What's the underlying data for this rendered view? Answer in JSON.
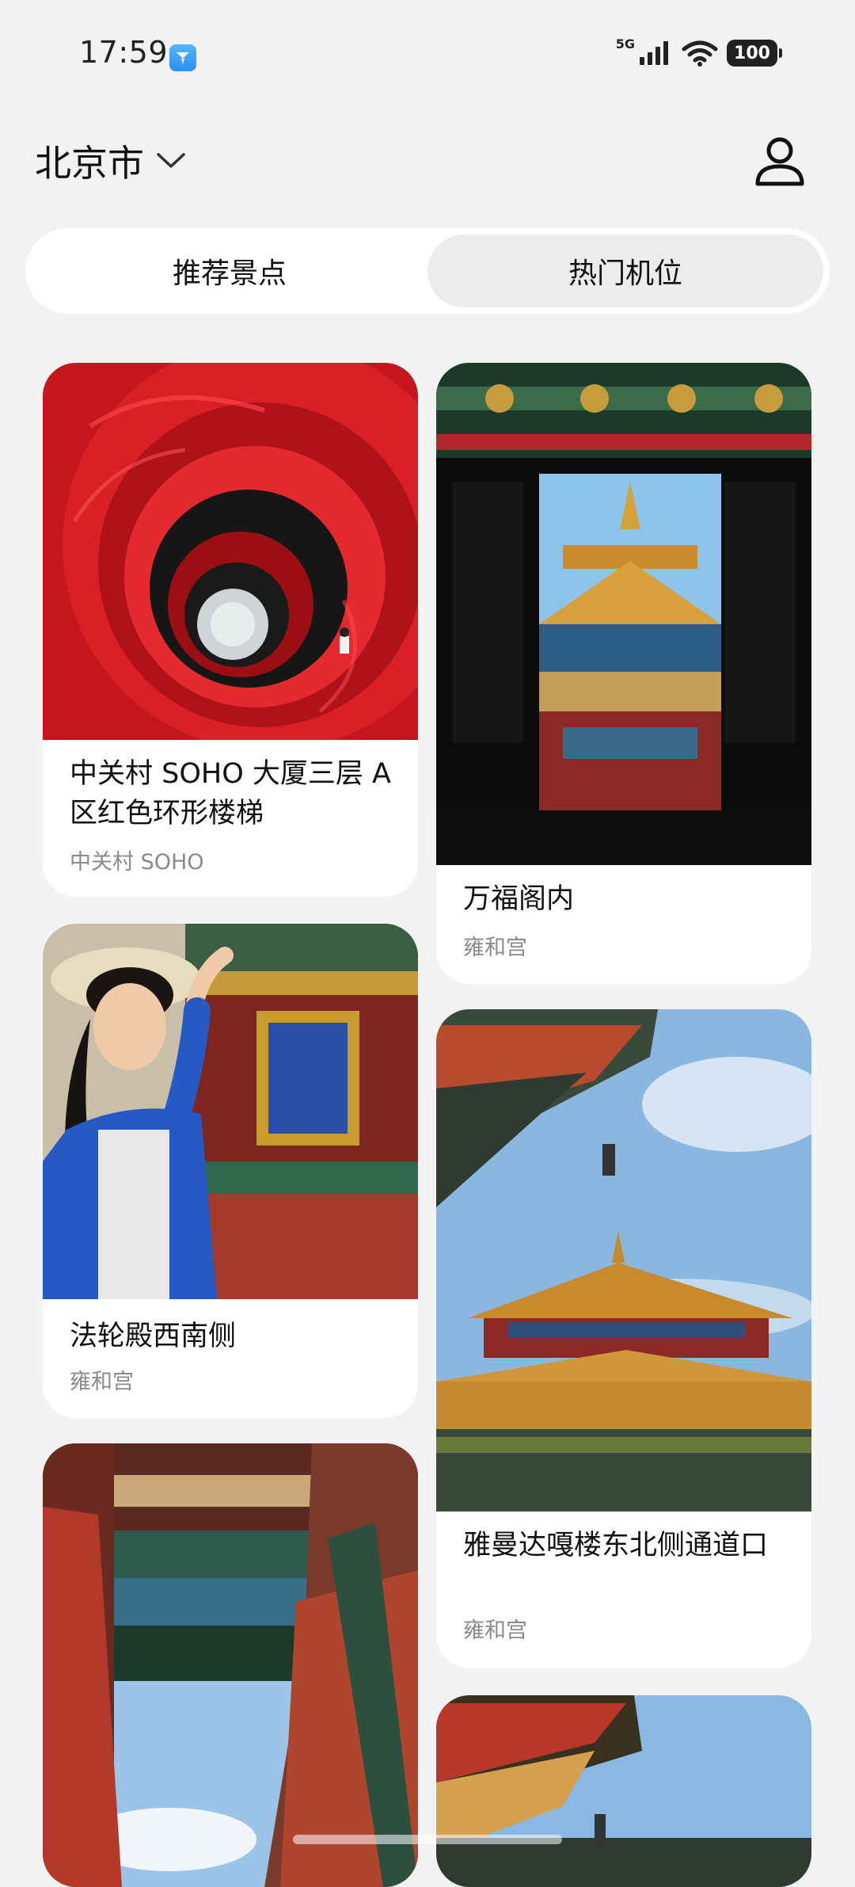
{
  "status": {
    "time": "17:59",
    "network": "5G",
    "battery": "100"
  },
  "header": {
    "city": "北京市"
  },
  "tabs": [
    {
      "label": "推荐景点"
    },
    {
      "label": "热门机位"
    }
  ],
  "cards": [
    {
      "title": "中关村 SOHO 大厦三层 A 区红色环形楼梯",
      "subtitle": "中关村 SOHO"
    },
    {
      "title": "万福阁内",
      "subtitle": "雍和宫"
    },
    {
      "title": "法轮殿西南侧",
      "subtitle": "雍和宫"
    },
    {
      "title": "雅曼达嘎楼东北侧通道口",
      "subtitle": "雍和宫"
    }
  ],
  "icons": {
    "app": "weather-app-icon",
    "dropdown": "chevron-down-icon",
    "profile": "user-profile-icon"
  },
  "colors": {
    "background": "#f2f2f2",
    "card": "#ffffff",
    "selected_tab": "#ececec",
    "subtitle": "#8a8a8a"
  }
}
